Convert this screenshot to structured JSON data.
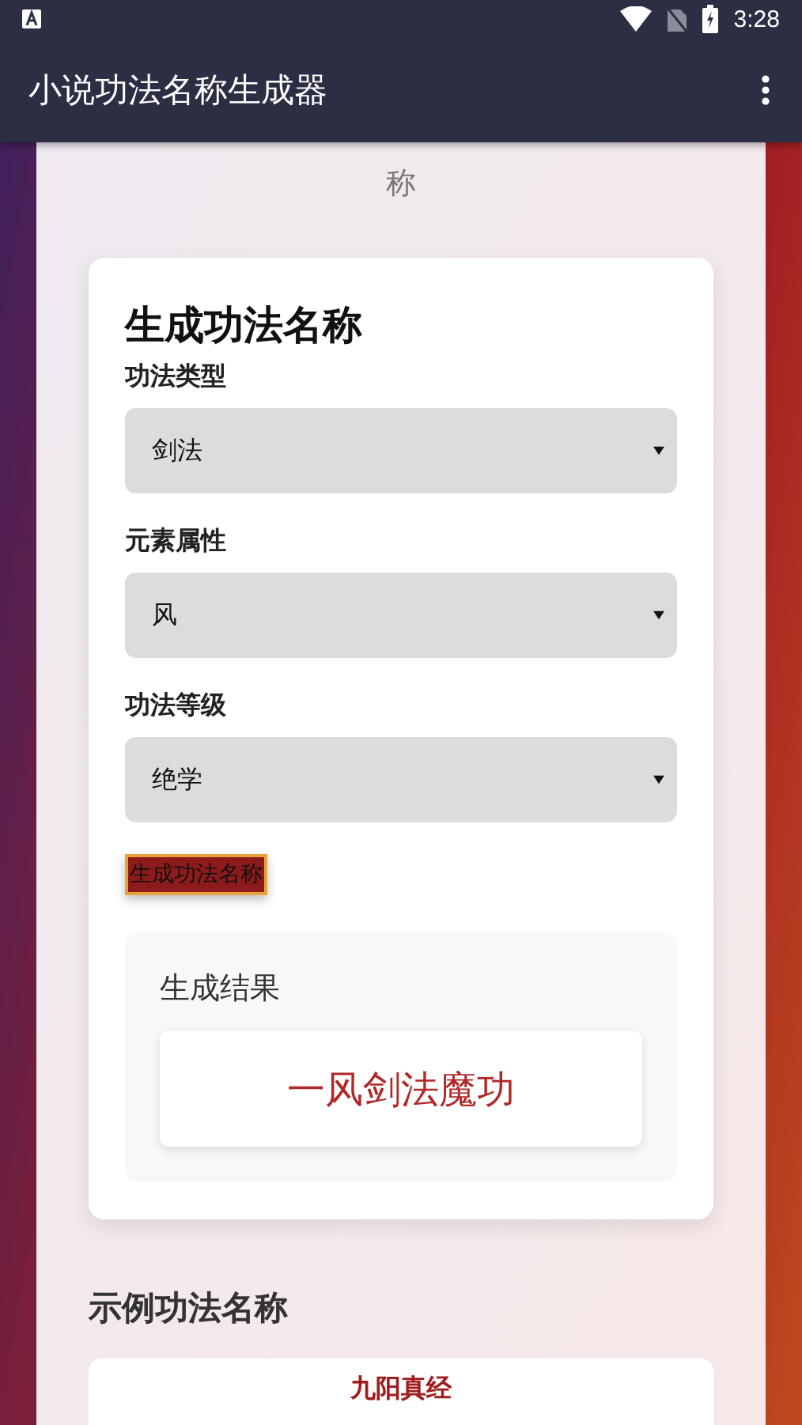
{
  "status_bar": {
    "time": "3:28"
  },
  "app_bar": {
    "title": "小说功法名称生成器"
  },
  "intro": {
    "text_tail": "称"
  },
  "generator": {
    "title": "生成功法名称",
    "fields": [
      {
        "label": "功法类型",
        "value": "剑法"
      },
      {
        "label": "元素属性",
        "value": "风"
      },
      {
        "label": "功法等级",
        "value": "绝学"
      }
    ],
    "button": "生成功法名称",
    "result": {
      "title": "生成结果",
      "name": "一风剑法魔功"
    }
  },
  "examples": {
    "title": "示例功法名称",
    "items": [
      "九阳真经"
    ]
  }
}
